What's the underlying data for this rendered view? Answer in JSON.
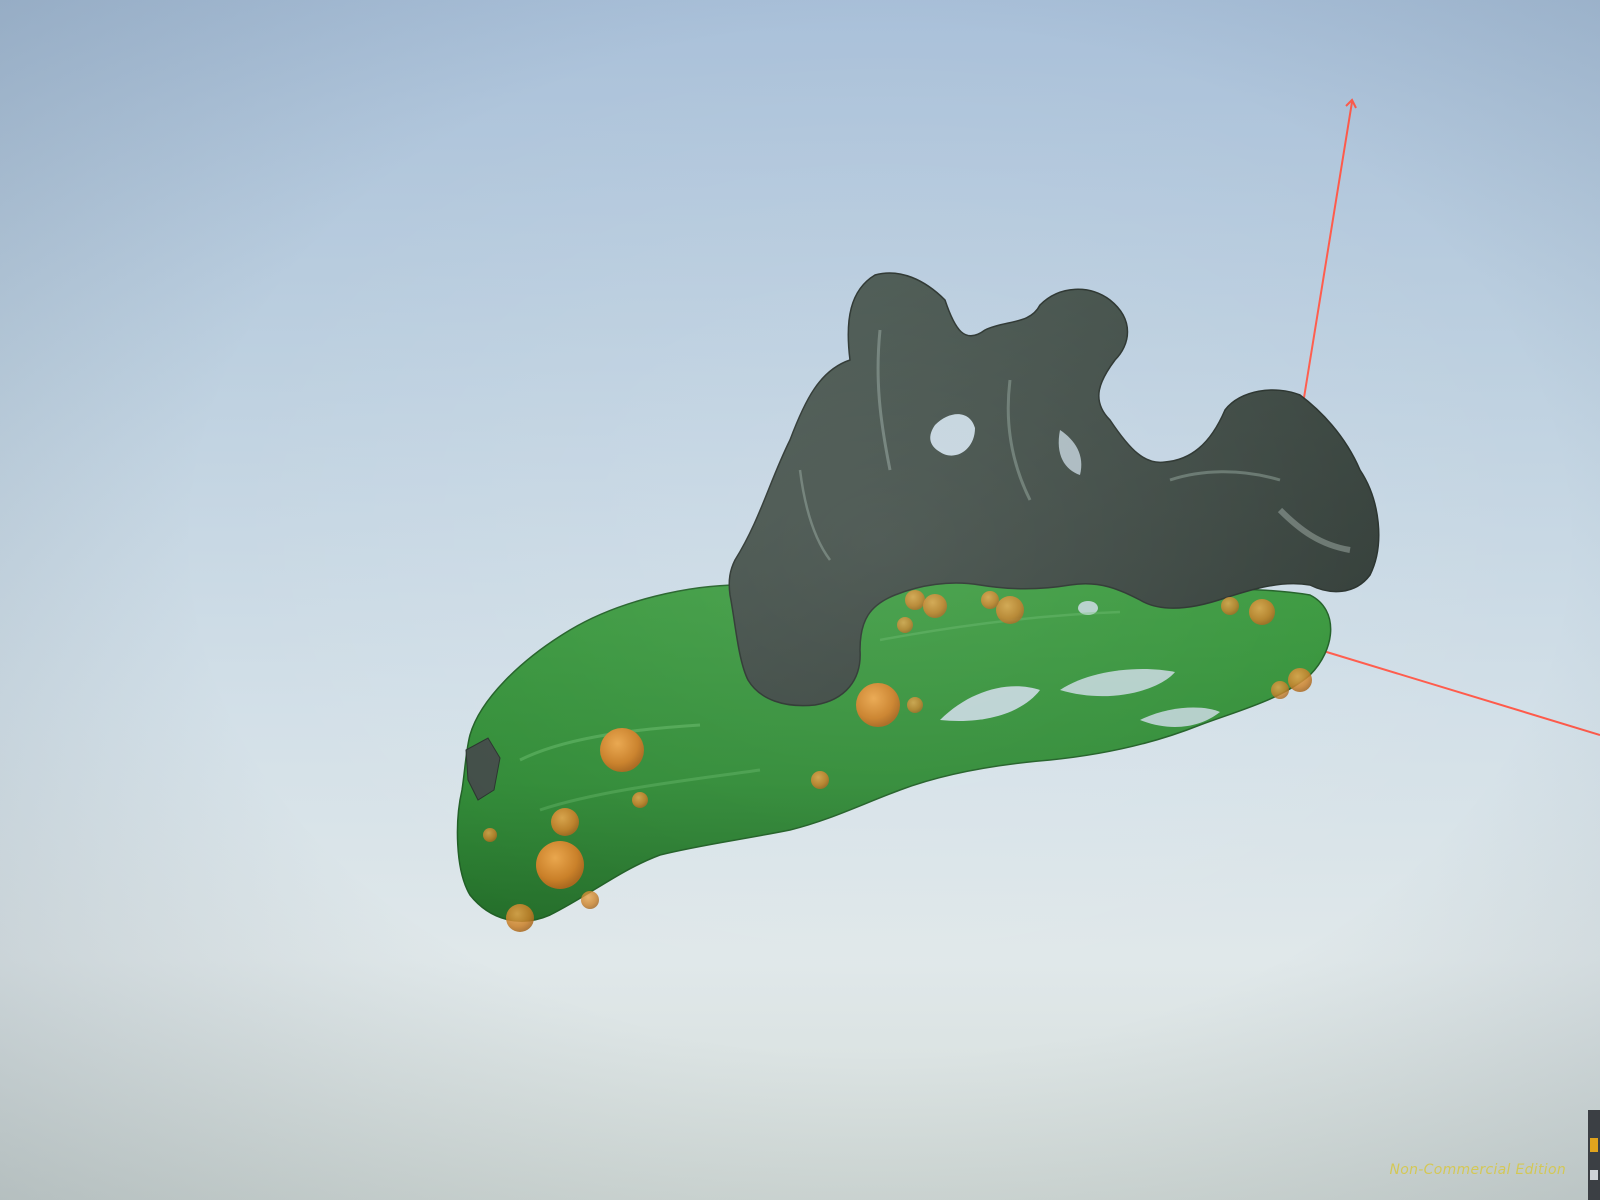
{
  "viewer": {
    "edition_label": "Non-Commercial Edition"
  },
  "scene": {
    "objects": [
      {
        "name": "green-mesh",
        "color": "#2f8a35"
      },
      {
        "name": "gray-mesh",
        "color": "#3f4b45"
      },
      {
        "name": "orange-spheres",
        "color": "#d68a2a"
      }
    ],
    "axis_color": "#ff5a4a"
  }
}
